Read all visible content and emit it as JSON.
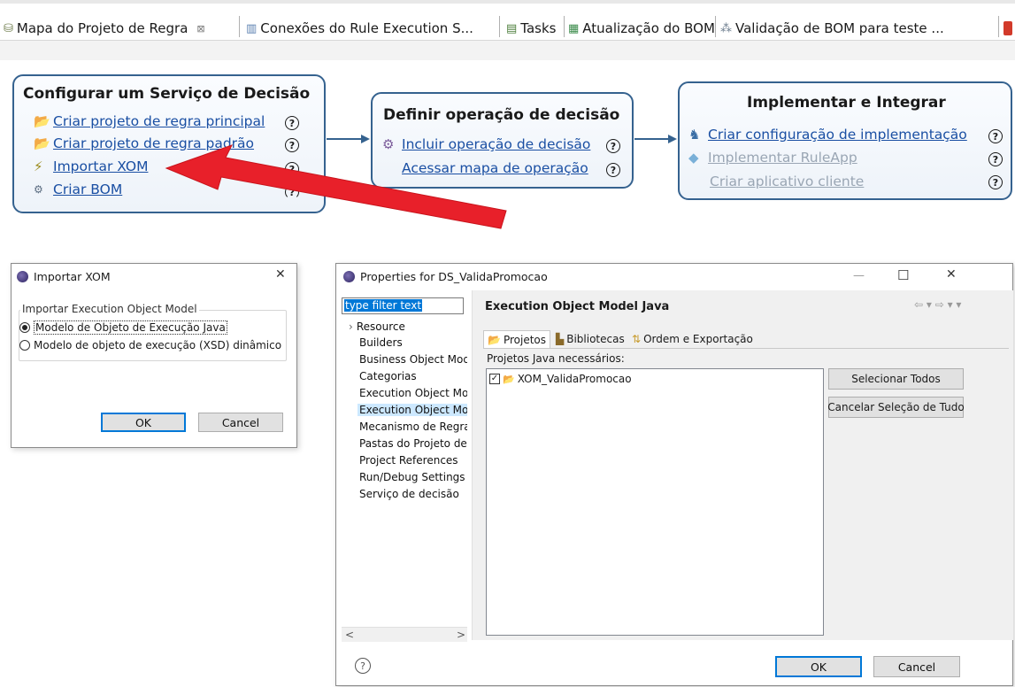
{
  "tabs": [
    {
      "label": "Mapa do Projeto de Regra",
      "close": "⊠",
      "icon": "rule-project-map-icon"
    },
    {
      "label": "Conexões do Rule Execution S...",
      "icon": "connections-icon"
    },
    {
      "label": "Tasks",
      "icon": "tasks-icon"
    },
    {
      "label": "Atualização do BOM",
      "icon": "bom-update-icon"
    },
    {
      "label": "Validação de BOM para teste ...",
      "icon": "bom-validation-icon"
    }
  ],
  "map": {
    "box1": {
      "title": "Configurar um Serviço de Decisão",
      "items": [
        {
          "label": "Criar projeto de regra principal",
          "icon": "folder-new-icon"
        },
        {
          "label": "Criar projeto de regra padrão",
          "icon": "folder-new-icon"
        },
        {
          "label": "Importar XOM",
          "icon": "lightning-icon"
        },
        {
          "label": "Criar BOM",
          "icon": "bom-icon"
        }
      ]
    },
    "box2": {
      "title": "Definir operação de decisão",
      "items": [
        {
          "label": "Incluir operação de decisão",
          "icon": "operation-icon"
        },
        {
          "label": "Acessar mapa de operação"
        }
      ]
    },
    "box3": {
      "title": "Implementar e Integrar",
      "items": [
        {
          "label": "Criar configuração de implementação",
          "icon": "deploy-config-icon",
          "enabled": true
        },
        {
          "label": "Implementar RuleApp",
          "icon": "ruleapp-icon",
          "enabled": false
        },
        {
          "label": "Criar aplicativo cliente",
          "enabled": false
        }
      ]
    },
    "help_glyph": "?",
    "arrow_color": "#e8202a",
    "accent": "#35628f"
  },
  "import_dialog": {
    "title": "Importar XOM",
    "close": "✕",
    "group_label": "Importar Execution Object Model",
    "options": [
      {
        "label": "Modelo de Objeto de Execução Java",
        "selected": true
      },
      {
        "label": "Modelo de objeto de execução (XSD) dinâmico",
        "selected": false
      }
    ],
    "ok": "OK",
    "cancel": "Cancel"
  },
  "props_dialog": {
    "title": "Properties for DS_ValidaPromocao",
    "minimize": "—",
    "maximize": "☐",
    "close": "✕",
    "filter_text": "type filter text",
    "nav": [
      {
        "label": "Resource",
        "expand": "›"
      },
      {
        "label": "Builders"
      },
      {
        "label": "Business Object Mode"
      },
      {
        "label": "Categorias"
      },
      {
        "label": "Execution Object Moc"
      },
      {
        "label": "Execution Object Moc",
        "selected": true
      },
      {
        "label": "Mecanismo de Regras"
      },
      {
        "label": "Pastas do Projeto de I"
      },
      {
        "label": "Project References"
      },
      {
        "label": "Run/Debug Settings"
      },
      {
        "label": "Serviço de decisão"
      }
    ],
    "page_title": "Execution Object Model Java",
    "nav_arrows": "⇦ ▾ ⇨ ▾ ▾",
    "tabs": [
      {
        "label": "Projetos",
        "active": true
      },
      {
        "label": "Bibliotecas"
      },
      {
        "label": "Ordem e Exportação"
      }
    ],
    "list_label": "Projetos Java necessários:",
    "projects": [
      {
        "label": "XOM_ValidaPromocao",
        "checked": true
      }
    ],
    "select_all": "Selecionar Todos",
    "deselect_all": "Cancelar Seleção de Tudo",
    "help_glyph": "?",
    "ok": "OK",
    "cancel": "Cancel",
    "scroll_left": "<",
    "scroll_right": ">"
  }
}
